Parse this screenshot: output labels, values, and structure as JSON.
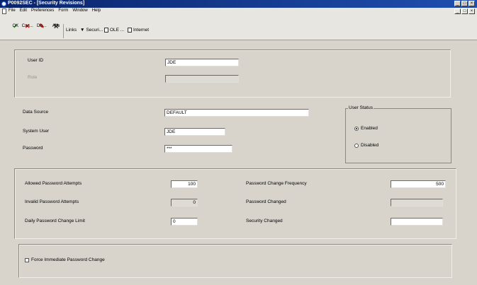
{
  "window": {
    "title": "P0092SEC - [Security Revisions]"
  },
  "menubar": {
    "items": [
      "File",
      "Edit",
      "Preferences",
      "Form",
      "Window",
      "Help"
    ]
  },
  "toolbar": {
    "ok_label": "OK",
    "cancel_label": "Can...",
    "display_label": "Dis...",
    "about_label": "Abo",
    "links_label": "Links",
    "security_label": "Securi...",
    "ole_label": "OLE ...",
    "internet_label": "Internet"
  },
  "user_panel": {
    "user_id_label": "User ID",
    "user_id_value": "JDE",
    "role_label": "Role",
    "role_value": ""
  },
  "account": {
    "data_source_label": "Data Source",
    "data_source_value": "DEFAULT",
    "system_user_label": "System User",
    "system_user_value": "JDE",
    "password_label": "Password",
    "password_value": "***"
  },
  "user_status": {
    "legend": "User Status",
    "enabled_label": "Enabled",
    "disabled_label": "Disabled",
    "selected": "Enabled"
  },
  "policy": {
    "allowed_attempts_label": "Allowed Password Attempts",
    "allowed_attempts_value": "100",
    "invalid_attempts_label": "Invalid Password Attempts",
    "invalid_attempts_value": "0",
    "daily_limit_label": "Daily Password Change Limit",
    "daily_limit_value": "0",
    "change_frequency_label": "Password Change Frequency",
    "change_frequency_value": "500",
    "password_changed_label": "Password Changed",
    "password_changed_value": "",
    "security_changed_label": "Security Changed",
    "security_changed_value": ""
  },
  "options": {
    "force_change_label": "Force Immediate Password Change"
  }
}
